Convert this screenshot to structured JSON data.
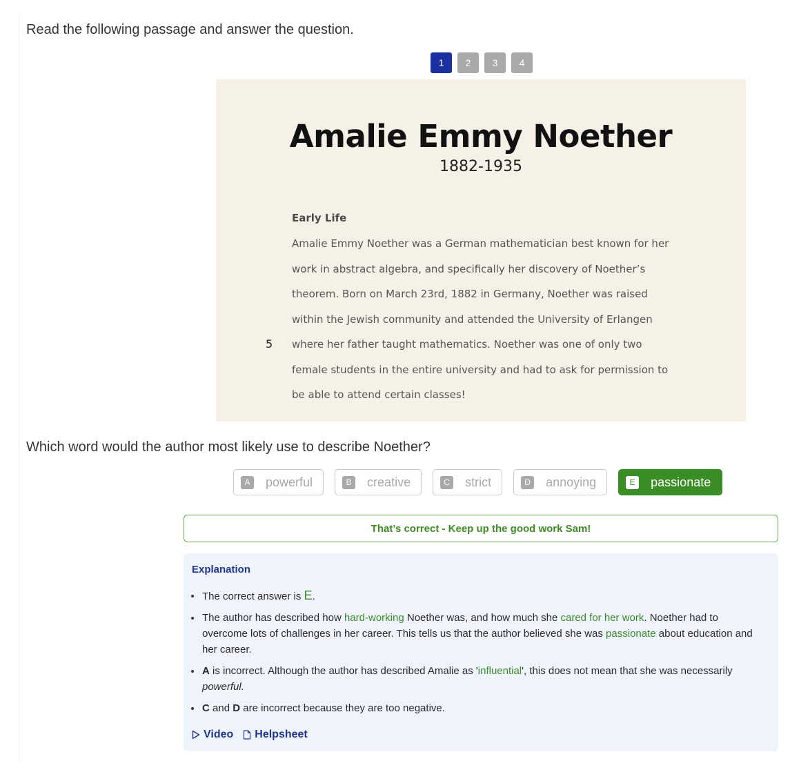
{
  "instruction": "Read the following passage and answer the question.",
  "pager": {
    "pages": [
      "1",
      "2",
      "3",
      "4"
    ],
    "active_page": "1"
  },
  "passage": {
    "title": "Amalie Emmy Noether",
    "dates": "1882-1935",
    "section_heading": "Early Life",
    "lines": [
      {
        "number": "",
        "text": "Amalie Emmy Noether was a German mathematician best known for her"
      },
      {
        "number": "",
        "text": "work in abstract algebra, and specifically her discovery of Noether’s"
      },
      {
        "number": "",
        "text": "theorem. Born on March 23rd, 1882 in Germany, Noether was raised"
      },
      {
        "number": "",
        "text": "within the Jewish community and attended the University of Erlangen"
      },
      {
        "number": "5",
        "text": "where her father taught mathematics. Noether was one of only two"
      },
      {
        "number": "",
        "text": "female students in the entire university and had to ask for permission to"
      },
      {
        "number": "",
        "text": "be able to attend certain classes!"
      }
    ]
  },
  "question": "Which word would the author most likely use to describe Noether?",
  "options": [
    {
      "letter": "A",
      "word": "powerful",
      "selected": false
    },
    {
      "letter": "B",
      "word": "creative",
      "selected": false
    },
    {
      "letter": "C",
      "word": "strict",
      "selected": false
    },
    {
      "letter": "D",
      "word": "annoying",
      "selected": false
    },
    {
      "letter": "E",
      "word": "passionate",
      "selected": true
    }
  ],
  "feedback": "That’s correct - Keep up the good work Sam!",
  "explanation": {
    "title": "Explanation",
    "bullet1": {
      "pre": "The correct answer is ",
      "answer": "E",
      "post": "."
    },
    "bullet2": {
      "t1": "The author has described how ",
      "h1": "hard-working",
      "t2": " Noether was, and how much she ",
      "h2": "cared for her work",
      "t3": ". Noether had to overcome lots of challenges in her career. This tells us that the author believed she was ",
      "h3": "passionate",
      "t4": " about education and her career."
    },
    "bullet3": {
      "b1": "A",
      "t1": " is incorrect. Although the author has described Amalie as '",
      "h1": "influential",
      "t2": "', this does not mean that she was necessarily ",
      "i1": "powerful.",
      "t3": ""
    },
    "bullet4": {
      "b1": "C",
      "t1": " and ",
      "b2": "D",
      "t2": " are incorrect because they are too negative."
    },
    "links": [
      {
        "icon": "play-icon",
        "label": "Video"
      },
      {
        "icon": "document-icon",
        "label": "Helpsheet"
      }
    ]
  },
  "colors": {
    "accent_blue": "#1a2fa0",
    "correct_green": "#3a8c24",
    "passage_bg": "#f5f1e7",
    "explanation_bg": "#eff4fc"
  }
}
